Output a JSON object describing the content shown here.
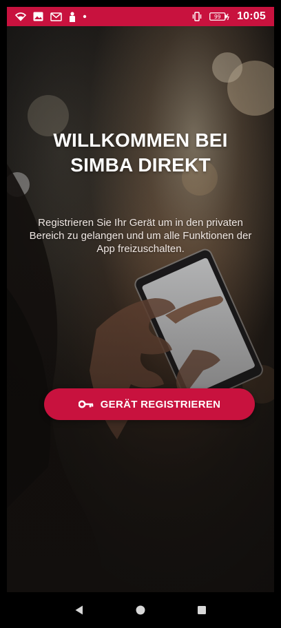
{
  "status_bar": {
    "time": "10:05",
    "battery_level": "99",
    "icons_left": [
      "wifi-icon",
      "image-icon",
      "gmail-icon",
      "person-icon",
      "dot-icon"
    ],
    "icons_right": [
      "vibrate-icon",
      "battery-icon"
    ],
    "color": "#c8123e"
  },
  "hero": {
    "title_lines": [
      "WILLKOMMEN BEI",
      "SIMBA DIREKT"
    ],
    "subtitle_lines": [
      "Registrieren Sie Ihr Gerät um in den privaten",
      "Bereich zu gelangen und um alle Funktionen der",
      "App freizuschalten."
    ]
  },
  "register_button": {
    "label": "GERÄT REGISTRIEREN",
    "icon": "key-icon",
    "color": "#c8123e"
  },
  "nav_bar": {
    "buttons": [
      "back-icon",
      "home-icon",
      "recents-icon"
    ]
  }
}
